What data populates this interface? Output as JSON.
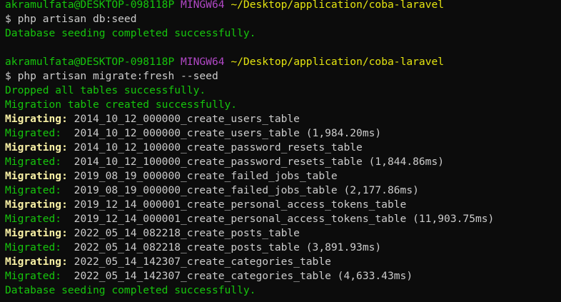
{
  "terminal": {
    "blocks": [
      {
        "prompt": {
          "user_host": "akramulfata@DESKTOP-098118P",
          "shell": "MINGW64",
          "path": "~/Desktop/application/coba-laravel"
        },
        "command": "$ php artisan db:seed",
        "output": [
          {
            "type": "success",
            "text": "Database seeding completed successfully."
          }
        ]
      },
      {
        "prompt": {
          "user_host": "akramulfata@DESKTOP-098118P",
          "shell": "MINGW64",
          "path": "~/Desktop/application/coba-laravel"
        },
        "command": "$ php artisan migrate:fresh --seed",
        "output": [
          {
            "type": "success",
            "text": "Dropped all tables successfully."
          },
          {
            "type": "success",
            "text": "Migration table created successfully."
          },
          {
            "type": "migrating",
            "label": "Migrating:",
            "text": " 2014_10_12_000000_create_users_table"
          },
          {
            "type": "migrated",
            "label": "Migrated: ",
            "text": " 2014_10_12_000000_create_users_table (1,984.20ms)"
          },
          {
            "type": "migrating",
            "label": "Migrating:",
            "text": " 2014_10_12_100000_create_password_resets_table"
          },
          {
            "type": "migrated",
            "label": "Migrated: ",
            "text": " 2014_10_12_100000_create_password_resets_table (1,844.86ms)"
          },
          {
            "type": "migrating",
            "label": "Migrating:",
            "text": " 2019_08_19_000000_create_failed_jobs_table"
          },
          {
            "type": "migrated",
            "label": "Migrated: ",
            "text": " 2019_08_19_000000_create_failed_jobs_table (2,177.86ms)"
          },
          {
            "type": "migrating",
            "label": "Migrating:",
            "text": " 2019_12_14_000001_create_personal_access_tokens_table"
          },
          {
            "type": "migrated",
            "label": "Migrated: ",
            "text": " 2019_12_14_000001_create_personal_access_tokens_table (11,903.75ms)"
          },
          {
            "type": "migrating",
            "label": "Migrating:",
            "text": " 2022_05_14_082218_create_posts_table"
          },
          {
            "type": "migrated",
            "label": "Migrated: ",
            "text": " 2022_05_14_082218_create_posts_table (3,891.93ms)"
          },
          {
            "type": "migrating",
            "label": "Migrating:",
            "text": " 2022_05_14_142307_create_categories_table"
          },
          {
            "type": "migrated",
            "label": "Migrated: ",
            "text": " 2022_05_14_142307_create_categories_table (4,633.43ms)"
          },
          {
            "type": "success",
            "text": "Database seeding completed successfully."
          }
        ]
      }
    ]
  }
}
